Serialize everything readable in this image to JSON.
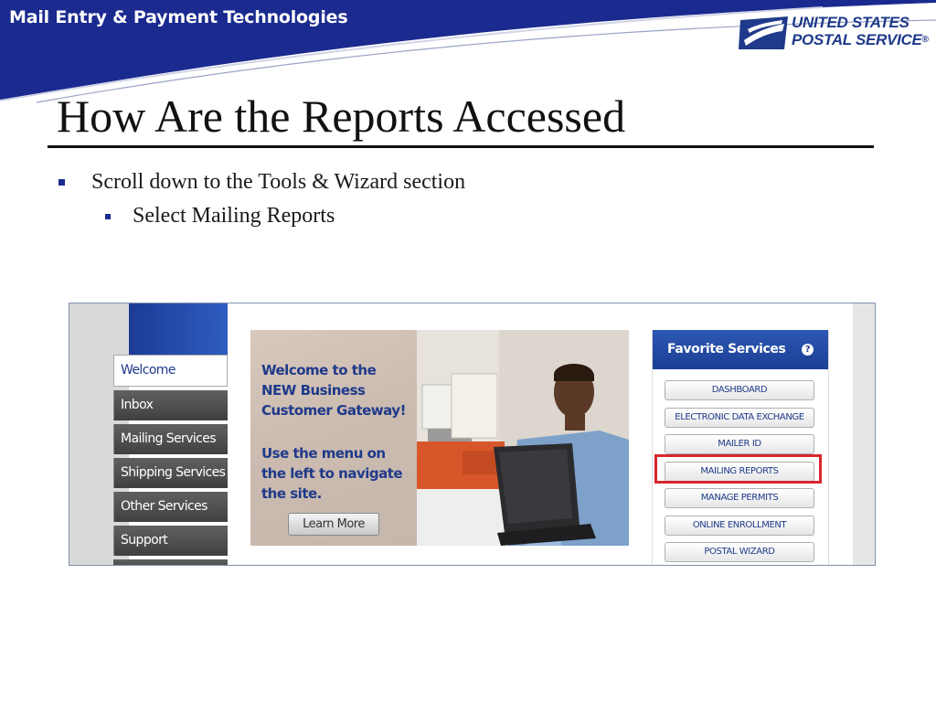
{
  "header": {
    "org_title": "Mail Entry & Payment Technologies",
    "logo_line1": "UNITED STATES",
    "logo_line2": "POSTAL SERVICE",
    "logo_reg": "®"
  },
  "slide": {
    "title": "How Are the Reports Accessed",
    "bullet1": "Scroll down to the Tools & Wizard section",
    "bullet2": "Select Mailing Reports"
  },
  "screenshot": {
    "nav": [
      "Welcome",
      "Inbox",
      "Mailing Services",
      "Shipping Services",
      "Other Services",
      "Support"
    ],
    "banner_heading": "Welcome to the NEW Business Customer Gateway!",
    "banner_sub": "Use the menu on the left to navigate the site.",
    "learn_more": "Learn More",
    "favorites_title": "Favorite Services",
    "favorites_help": "?",
    "favorites": [
      "DASHBOARD",
      "ELECTRONIC DATA EXCHANGE",
      "MAILER ID",
      "MAILING REPORTS",
      "MANAGE PERMITS",
      "ONLINE ENROLLMENT",
      "POSTAL WIZARD"
    ],
    "highlighted": "MAILING REPORTS"
  },
  "colors": {
    "header_blue": "#1b2a8f",
    "usps_blue": "#1f3a8a",
    "highlight_red": "#d7262e"
  }
}
